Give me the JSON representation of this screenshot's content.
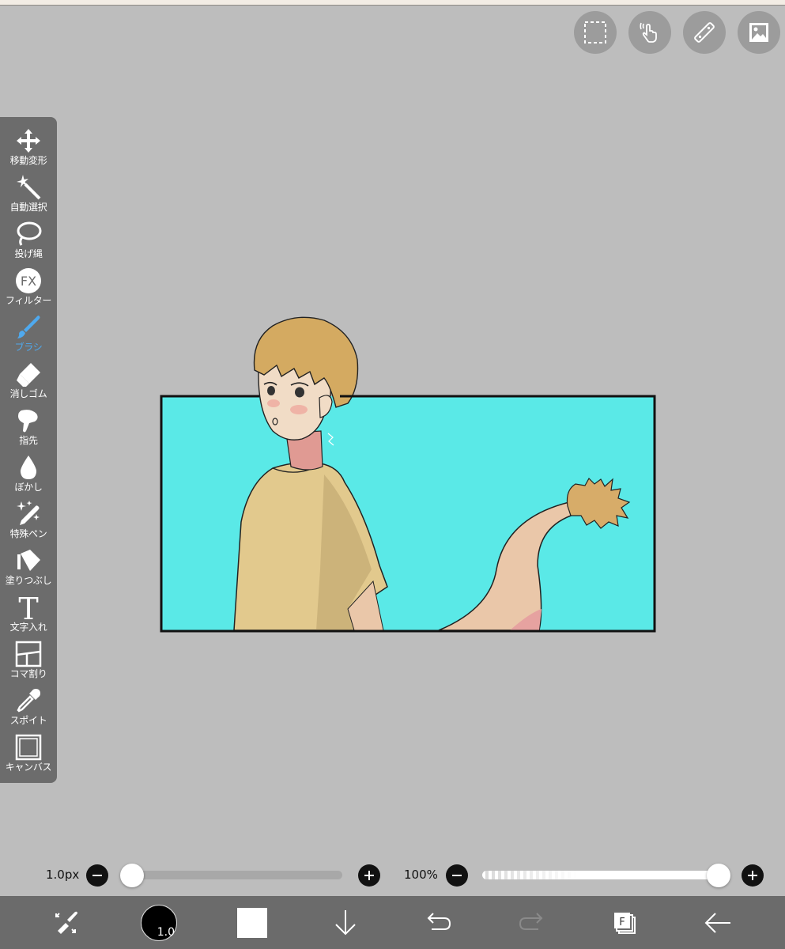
{
  "top_tools": [
    {
      "name": "selection-tool-button",
      "icon": "dashed-select-icon"
    },
    {
      "name": "gesture-button",
      "icon": "hand-touch-icon"
    },
    {
      "name": "ruler-button",
      "icon": "ruler-icon"
    },
    {
      "name": "material-button",
      "icon": "image-icon"
    }
  ],
  "toolbar": {
    "items": [
      {
        "id": "move",
        "label": "移動変形",
        "icon": "move-arrows-icon"
      },
      {
        "id": "magic",
        "label": "自動選択",
        "icon": "magic-wand-icon"
      },
      {
        "id": "lasso",
        "label": "投げ縄",
        "icon": "lasso-icon"
      },
      {
        "id": "filter",
        "label": "フィルター",
        "icon": "fx-icon",
        "icon_text": "FX"
      },
      {
        "id": "brush",
        "label": "ブラシ",
        "icon": "brush-icon",
        "active": true
      },
      {
        "id": "eraser",
        "label": "消しゴム",
        "icon": "eraser-icon"
      },
      {
        "id": "smudge",
        "label": "指先",
        "icon": "finger-icon"
      },
      {
        "id": "blur",
        "label": "ぼかし",
        "icon": "droplet-icon"
      },
      {
        "id": "special",
        "label": "特殊ペン",
        "icon": "sparkle-pen-icon"
      },
      {
        "id": "fill",
        "label": "塗りつぶし",
        "icon": "bucket-icon"
      },
      {
        "id": "text",
        "label": "文字入れ",
        "icon": "text-icon",
        "icon_text": "T"
      },
      {
        "id": "frame",
        "label": "コマ割り",
        "icon": "frame-divider-icon"
      },
      {
        "id": "eyedropper",
        "label": "スポイト",
        "icon": "eyedropper-icon"
      },
      {
        "id": "canvas",
        "label": "キャンバス",
        "icon": "canvas-icon"
      }
    ],
    "active_color": "#4fa9ee"
  },
  "canvas": {
    "panel_background": "#5ae9e7",
    "border_color": "#111111"
  },
  "brush_size": {
    "label": "1.0px",
    "value": 1.0,
    "min": 0,
    "max": 1000
  },
  "opacity": {
    "label": "100%",
    "value": 100
  },
  "bottom_bar": {
    "brush_size_label": "1.0",
    "color": "#ffffff",
    "layer_label": "F",
    "items": [
      "transform-icon",
      "brush-size",
      "color-swatch",
      "download-icon",
      "undo-icon",
      "redo-icon",
      "layers-icon",
      "back-icon"
    ]
  }
}
